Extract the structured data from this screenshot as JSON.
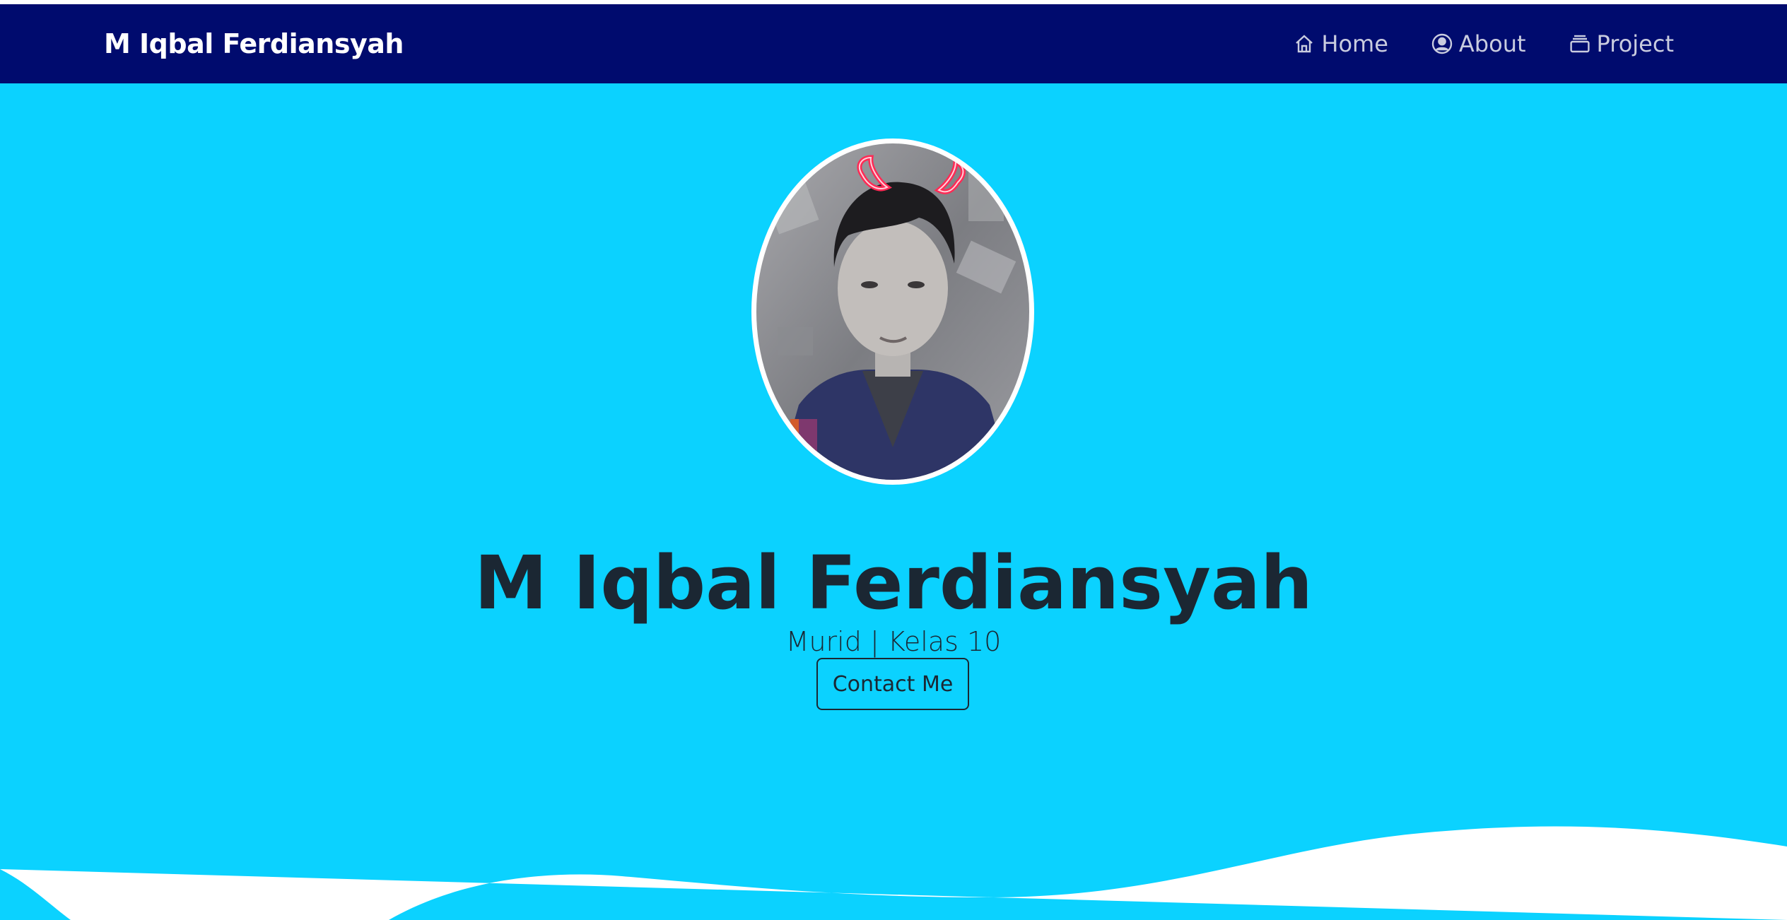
{
  "navbar": {
    "brand": "M Iqbal Ferdiansyah",
    "items": [
      {
        "label": "Home",
        "icon": "home-icon"
      },
      {
        "label": "About",
        "icon": "user-circle-icon"
      },
      {
        "label": "Project",
        "icon": "collection-icon"
      }
    ]
  },
  "hero": {
    "name": "M Iqbal Ferdiansyah",
    "subtitle": "Murid | Kelas 10",
    "contact_label": "Contact Me"
  },
  "colors": {
    "navbar_bg": "#000b6e",
    "hero_bg": "#0bd2ff",
    "text_dark": "#1b2733",
    "nav_text": "#c9ccdf"
  }
}
